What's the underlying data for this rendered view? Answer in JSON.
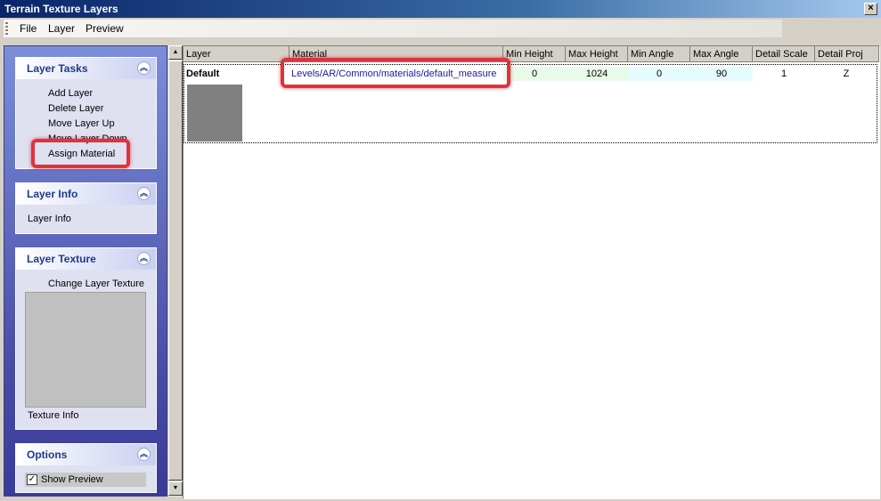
{
  "window": {
    "title": "Terrain Texture Layers",
    "close_label": "×"
  },
  "menu": {
    "file": "File",
    "layer": "Layer",
    "preview": "Preview"
  },
  "task_panel": {
    "layer_tasks": {
      "title": "Layer Tasks",
      "items": [
        "Add Layer",
        "Delete Layer",
        "Move Layer Up",
        "Move Layer Down",
        "Assign Material"
      ]
    },
    "layer_info": {
      "title": "Layer Info",
      "content": "Layer Info"
    },
    "layer_texture": {
      "title": "Layer Texture",
      "action": "Change Layer Texture",
      "info": "Texture Info"
    },
    "options": {
      "title": "Options",
      "show_preview_label": "Show Preview",
      "show_preview_checked": true
    }
  },
  "grid": {
    "columns": [
      "Layer",
      "Material",
      "Min Height",
      "Max Height",
      "Min Angle",
      "Max Angle",
      "Detail Scale",
      "Detail Proj"
    ],
    "rows": [
      {
        "layer": "Default",
        "material": "Levels/AR/Common/materials/default_measure",
        "min_height": "0",
        "max_height": "1024",
        "min_angle": "0",
        "max_angle": "90",
        "detail_scale": "1",
        "detail_proj": "Z"
      }
    ]
  },
  "colors": {
    "highlight": "#e0323c",
    "link": "#1a1aa6",
    "height_bg": "#e8fbe8",
    "angle_bg": "#e6fbff"
  }
}
